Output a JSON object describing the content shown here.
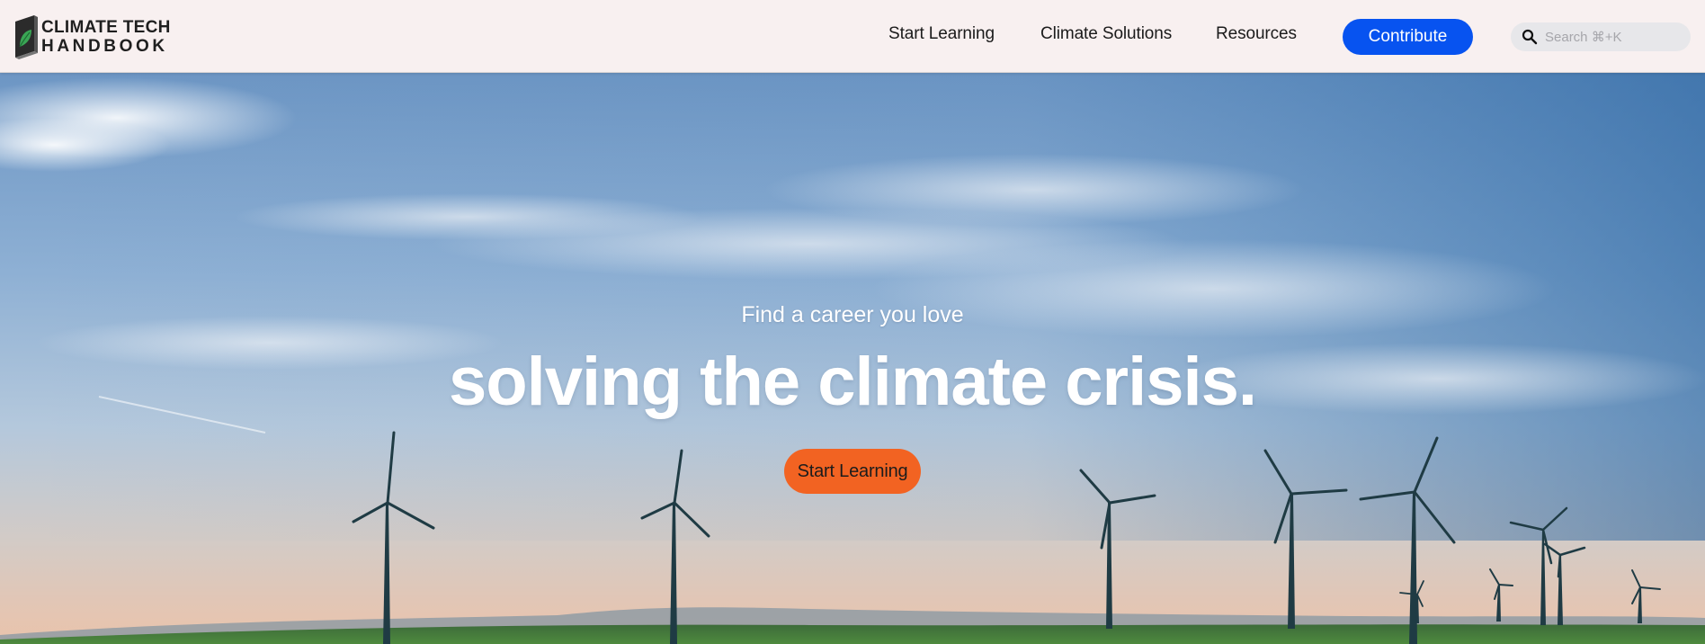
{
  "header": {
    "logo": {
      "line1": "CLIMATE TECH",
      "line2": "HANDBOOK"
    },
    "nav": [
      {
        "label": "Start Learning"
      },
      {
        "label": "Climate Solutions"
      },
      {
        "label": "Resources"
      }
    ],
    "contribute_label": "Contribute",
    "search": {
      "placeholder": "Search ⌘+K",
      "value": "",
      "icon": "search-icon"
    }
  },
  "hero": {
    "subtitle": "Find a career you love",
    "title": "solving the climate crisis.",
    "cta_label": "Start Learning"
  },
  "colors": {
    "header_bg": "#f8f0f0",
    "contribute_bg": "#0753f0",
    "cta_bg": "#f26322",
    "logo_leaf": "#3aa655",
    "logo_book": "#2b2b2b"
  }
}
